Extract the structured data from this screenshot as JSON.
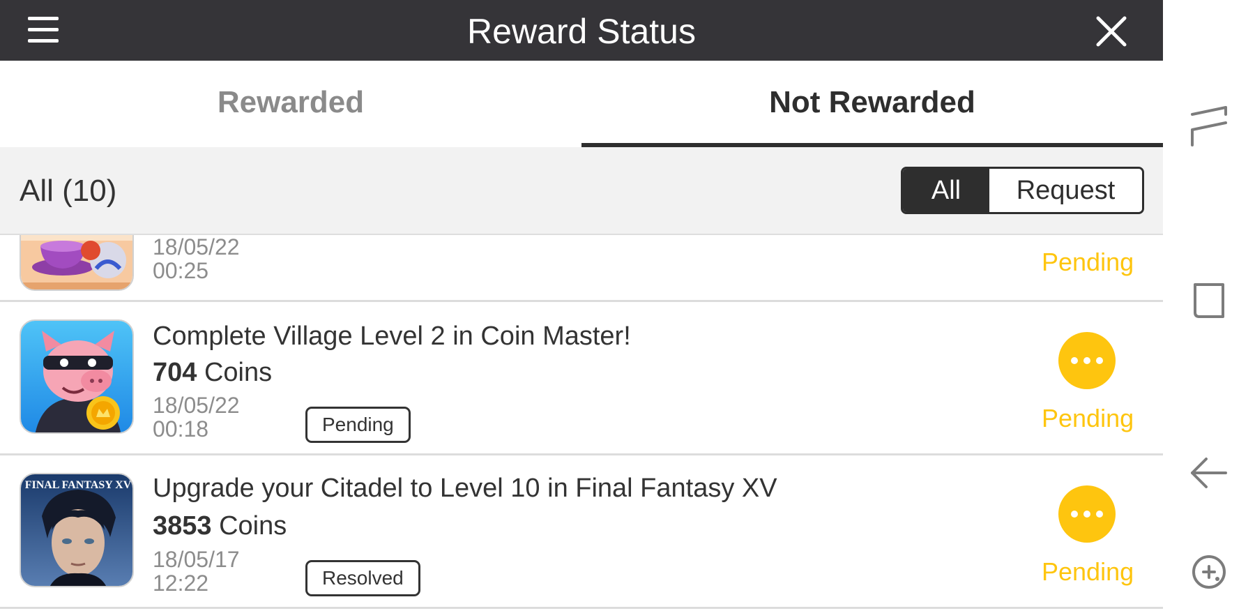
{
  "header": {
    "title": "Reward Status"
  },
  "tabs": [
    {
      "label": "Rewarded"
    },
    {
      "label": "Not Rewarded"
    }
  ],
  "filter": {
    "count_label": "All (10)",
    "options": [
      "All",
      "Request"
    ],
    "selected": "All"
  },
  "rows": [
    {
      "date": "18/05/22",
      "time": "00:25",
      "status": "Pending"
    },
    {
      "title": "Complete Village Level 2 in Coin Master!",
      "coins": "704",
      "coins_unit": "Coins",
      "date": "18/05/22",
      "time": "00:18",
      "badge": "Pending",
      "status": "Pending"
    },
    {
      "title": "Upgrade your Citadel to Level 10 in Final Fantasy XV",
      "coins": "3853",
      "coins_unit": "Coins",
      "date": "18/05/17",
      "time": "12:22",
      "badge": "Resolved",
      "status": "Pending",
      "icon_text": "FINAL FANTASY XV"
    }
  ],
  "colors": {
    "header_bg": "#353438",
    "accent_yellow": "#fec50f",
    "filter_bg": "#f2f2f2",
    "active_dark": "#2e2e2e"
  },
  "icons": [
    "menu-icon",
    "close-icon",
    "recent-apps-icon",
    "home-icon",
    "back-icon",
    "game-tools-icon",
    "more-icon"
  ]
}
